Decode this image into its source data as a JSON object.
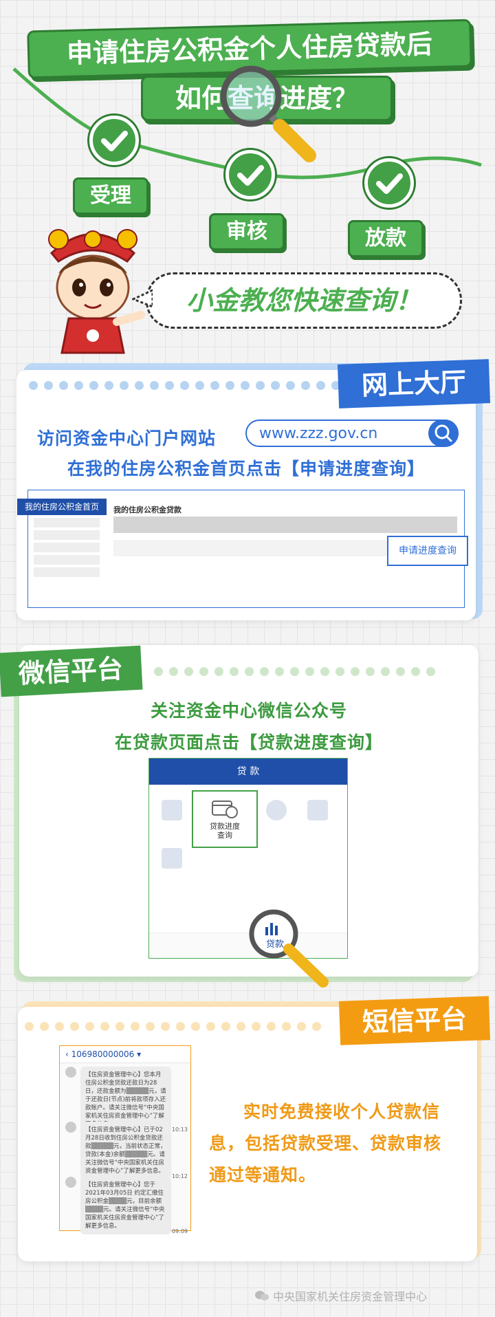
{
  "header": {
    "title_line1": "申请住房公积金个人住房贷款后",
    "title_line2": "如何查询进度？",
    "steps": [
      "受理",
      "审核",
      "放款"
    ],
    "slogan": "小金教您快速查询！"
  },
  "online": {
    "ribbon": "网上大厅",
    "line1": "访问资金中心门户网站",
    "url": "www.zzz.gov.cn",
    "line2": "在我的住房公积金首页点击【申请进度查询】",
    "tab_label": "我的住房公积金首页",
    "panel_title": "我的住房公积金贷款",
    "button_label": "申请进度查询"
  },
  "wechat": {
    "ribbon": "微信平台",
    "line1": "关注资金中心微信公众号",
    "line2": "在贷款页面点击【贷款进度查询】",
    "phone_header": "贷 款",
    "highlight_item": "贷款进度\n查询",
    "magnifier_label": "贷款"
  },
  "sms": {
    "ribbon": "短信平台",
    "sender": "106980000006",
    "messages": [
      {
        "text": "【住房资金管理中心】您本月住房公积金贷款还款日为28日，还款金额为▒▒▒▒▒元，请于还款日(节点)前将款项存入还款账户。请关注微信号“中央国家机关住房资金管理中心”了解更多信息。",
        "time": "10:13"
      },
      {
        "text": "【住房资金管理中心】已于02月28日收到住房公积金贷款还款▒▒▒▒▒元，当前状态正常，贷款(本金)余额▒▒▒▒▒元。请关注微信号“中央国家机关住房资金管理中心”了解更多信息。",
        "time": "10:12"
      },
      {
        "text": "【住房资金管理中心】您于2021年03月05日 约定汇缴住房公积金▒▒▒▒元，目前余额▒▒▒▒元。请关注微信号“中央国家机关住房资金管理中心”了解更多信息。",
        "time": "09:09"
      }
    ],
    "description": "实时免费接收个人贷款信息，包括贷款受理、贷款审核通过等通知。"
  },
  "footer": {
    "watermark": "中央国家机关住房资金管理中心"
  },
  "colors": {
    "green": "#4caf50",
    "blue": "#2f6fd6",
    "orange": "#f39c12",
    "dark_green": "#2e7d32"
  }
}
